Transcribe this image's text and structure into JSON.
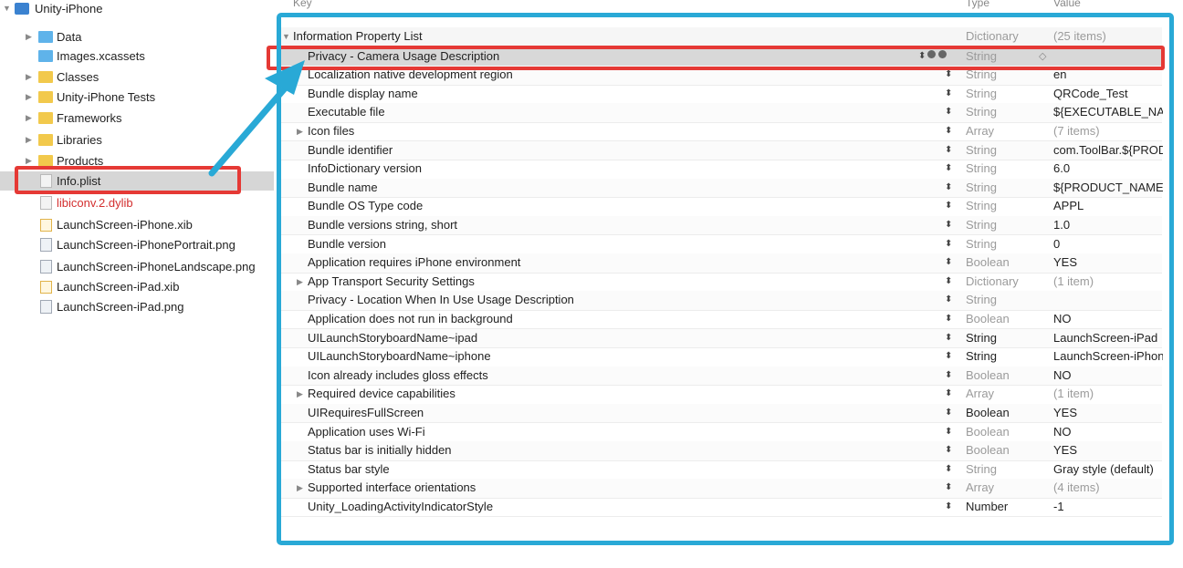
{
  "navigator": {
    "items": [
      {
        "label": "Unity-iPhone",
        "icon": "project-icon",
        "expanded": true
      },
      {
        "label": "Data",
        "icon": "folder-icon"
      },
      {
        "label": "Images.xcassets",
        "icon": "asset-catalog-icon"
      },
      {
        "label": "Classes",
        "icon": "folder-icon"
      },
      {
        "label": "Unity-iPhone Tests",
        "icon": "folder-icon"
      },
      {
        "label": "Frameworks",
        "icon": "folder-icon"
      },
      {
        "label": "Libraries",
        "icon": "folder-icon"
      },
      {
        "label": "Products",
        "icon": "folder-icon"
      },
      {
        "label": "Info.plist",
        "icon": "plist-file-icon",
        "selected": true
      },
      {
        "label": "libiconv.2.dylib",
        "icon": "library-icon",
        "color": "#d32f2f"
      },
      {
        "label": "LaunchScreen-iPhone.xib",
        "icon": "xib-file-icon"
      },
      {
        "label": "LaunchScreen-iPhonePortrait.png",
        "icon": "png-file-icon"
      },
      {
        "label": "LaunchScreen-iPhoneLandscape.png",
        "icon": "png-file-icon"
      },
      {
        "label": "LaunchScreen-iPad.xib",
        "icon": "xib-file-icon"
      },
      {
        "label": "LaunchScreen-iPad.png",
        "icon": "png-file-icon"
      }
    ]
  },
  "plist": {
    "header": {
      "key": "Key",
      "type": "Type",
      "value": "Value"
    },
    "root": {
      "key": "Information Property List",
      "type": "Dictionary",
      "value": "(25 items)"
    },
    "rows": [
      {
        "key": "Privacy - Camera Usage Description",
        "type": "String",
        "value": ""
      },
      {
        "key": "Localization native development region",
        "type": "String",
        "value": "en"
      },
      {
        "key": "Bundle display name",
        "type": "String",
        "value": "QRCode_Test"
      },
      {
        "key": "Executable file",
        "type": "String",
        "value": "${EXECUTABLE_NAME}"
      },
      {
        "key": "Icon files",
        "type": "Array",
        "value": "(7 items)"
      },
      {
        "key": "Bundle identifier",
        "type": "String",
        "value": "com.ToolBar.${PRODUCT_NAME}"
      },
      {
        "key": "InfoDictionary version",
        "type": "String",
        "value": "6.0"
      },
      {
        "key": "Bundle name",
        "type": "String",
        "value": "${PRODUCT_NAME}"
      },
      {
        "key": "Bundle OS Type code",
        "type": "String",
        "value": "APPL"
      },
      {
        "key": "Bundle versions string, short",
        "type": "String",
        "value": "1.0"
      },
      {
        "key": "Bundle version",
        "type": "String",
        "value": "0"
      },
      {
        "key": "Application requires iPhone environment",
        "type": "Boolean",
        "value": "YES"
      },
      {
        "key": "App Transport Security Settings",
        "type": "Dictionary",
        "value": "(1 item)"
      },
      {
        "key": "Privacy - Location When In Use Usage Description",
        "type": "String",
        "value": ""
      },
      {
        "key": "Application does not run in background",
        "type": "Boolean",
        "value": "NO"
      },
      {
        "key": "UILaunchStoryboardName~ipad",
        "type": "String",
        "value": "LaunchScreen-iPad"
      },
      {
        "key": "UILaunchStoryboardName~iphone",
        "type": "String",
        "value": "LaunchScreen-iPhone"
      },
      {
        "key": "Icon already includes gloss effects",
        "type": "Boolean",
        "value": "NO"
      },
      {
        "key": "Required device capabilities",
        "type": "Array",
        "value": "(1 item)"
      },
      {
        "key": "UIRequiresFullScreen",
        "type": "Boolean",
        "value": "YES"
      },
      {
        "key": "Application uses Wi-Fi",
        "type": "Boolean",
        "value": "NO"
      },
      {
        "key": "Status bar is initially hidden",
        "type": "Boolean",
        "value": "YES"
      },
      {
        "key": "Status bar style",
        "type": "String",
        "value": "Gray style (default)"
      },
      {
        "key": "Supported interface orientations",
        "type": "Array",
        "value": "(4 items)"
      },
      {
        "key": "Unity_LoadingActivityIndicatorStyle",
        "type": "Number",
        "value": "-1"
      }
    ]
  },
  "colors": {
    "highlight_box": "#e53935",
    "focus_frame": "#29a9d6",
    "arrow": "#29a9d6"
  }
}
